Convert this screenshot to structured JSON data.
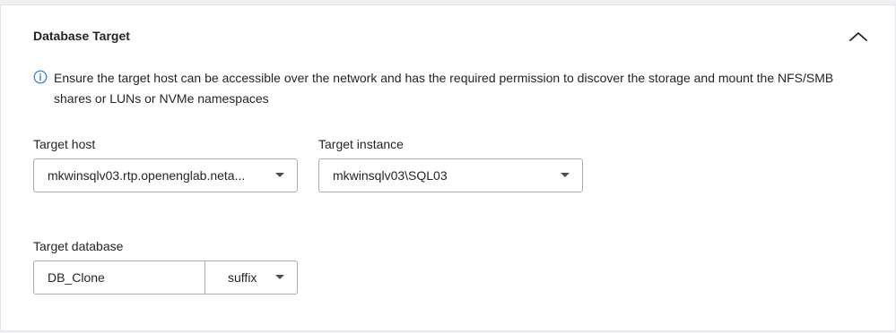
{
  "section": {
    "title": "Database Target",
    "info_text": "Ensure the target host can be accessible over the network and has the required permission to discover the storage and mount the NFS/SMB shares or LUNs or NVMe namespaces"
  },
  "fields": {
    "target_host": {
      "label": "Target host",
      "value": "mkwinsqlv03.rtp.openenglab.neta..."
    },
    "target_instance": {
      "label": "Target instance",
      "value": "mkwinsqlv03\\SQL03"
    },
    "target_database": {
      "label": "Target database",
      "value": "DB_Clone",
      "suffix_option": "suffix"
    }
  },
  "icons": {
    "info": "info-circle-icon",
    "collapse": "chevron-up-icon",
    "dropdown": "caret-down-icon"
  },
  "colors": {
    "info_icon": "#2b7ad6",
    "border": "#a9aeb4",
    "text": "#1f2328"
  }
}
